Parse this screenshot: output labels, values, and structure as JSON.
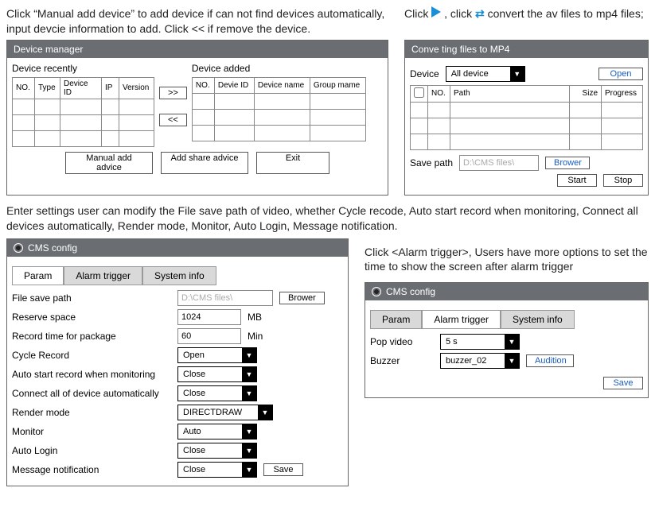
{
  "top": {
    "left": "Click “Manual add device” to add device if can not find devices automatically, input devcie information to add. Click << if remove the device.",
    "right_pre": "Click ",
    "right_mid": " , click ",
    "right_post": " convert the av files to mp4 files;"
  },
  "dmgr": {
    "title": "Device manager",
    "recently": "Device recently",
    "added": "Device added",
    "cols_left": {
      "no": "NO.",
      "type": "Type",
      "did": "Device ID",
      "ip": "IP",
      "ver": "Version"
    },
    "cols_right": {
      "no": "NO.",
      "did": "Devie ID",
      "dname": "Device name",
      "gname": "Group mame"
    },
    "toR": ">>",
    "toL": "<<",
    "manual": "Manual add advice",
    "share": "Add share advice",
    "exit": "Exit"
  },
  "conv": {
    "title": "Conve ting files to MP4",
    "device": "Device",
    "all": "All device",
    "open": "Open",
    "cols": {
      "chk": "",
      "no": "NO.",
      "path": "Path",
      "size": "Size",
      "prog": "Progress"
    },
    "savepath": "Save path",
    "savepath_val": "D:\\CMS files\\",
    "browser": "Brower",
    "start": "Start",
    "stop": "Stop"
  },
  "mid": "Enter settings user can modify the File save path of video,  whether Cycle recode, Auto start record when monitoring,  Connect all devices automatically, Render mode, Monitor, Auto Login, Message notification.",
  "cfg1": {
    "title": "CMS config",
    "tab1": "Param",
    "tab2": "Alarm trigger",
    "tab3": "System info",
    "r1": "File save path",
    "r1v": "D:\\CMS files\\",
    "browser": "Brower",
    "r2": "Reserve space",
    "r2v": "1024",
    "r2u": "MB",
    "r3": "Record  time for package",
    "r3v": "60",
    "r3u": "Min",
    "r4": "Cycle Record",
    "r4v": "Open",
    "r5": "Auto start record when monitoring",
    "r5v": "Close",
    "r6": "Connect all of device automatically",
    "r6v": "Close",
    "r7": "Render mode",
    "r7v": "DIRECTDRAW",
    "r8": "Monitor",
    "r8v": "Auto",
    "r9": "Auto Login",
    "r9v": "Close",
    "r10": "Message notification",
    "r10v": "Close",
    "save": "Save"
  },
  "rt": {
    "intro": "Click <Alarm trigger>, Users have more options to set the time to show the screen after alarm trigger",
    "title": "CMS config",
    "tab1": "Param",
    "tab2": "Alarm trigger",
    "tab3": "System info",
    "pop": "Pop video",
    "popv": "5 s",
    "buz": "Buzzer",
    "buzv": "buzzer_02",
    "aud": "Audition",
    "save": "Save"
  }
}
